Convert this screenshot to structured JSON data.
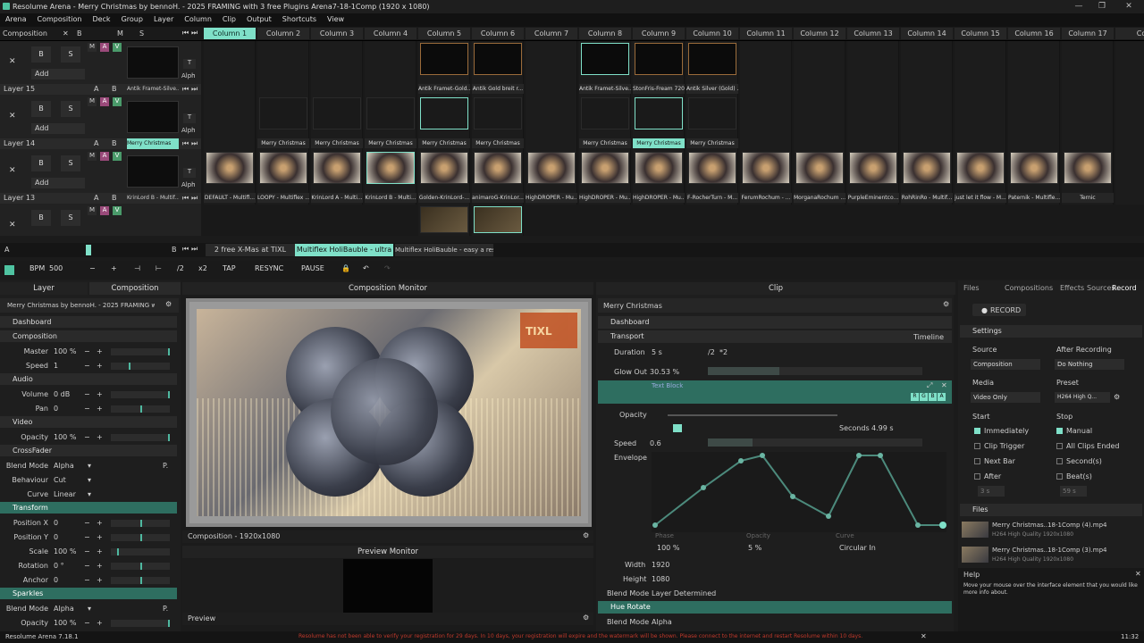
{
  "window": {
    "title": "Resolume Arena - Merry Christmas  by bennoH. - 2025  FRAMING  with 3 free Plugins Arena7-18-1Comp  (1920 x 1080)"
  },
  "menu": [
    "Arena",
    "Composition",
    "Deck",
    "Group",
    "Layer",
    "Column",
    "Clip",
    "Output",
    "Shortcuts",
    "View"
  ],
  "composition_label": "Composition",
  "columns": [
    "Column 1",
    "Column 2",
    "Column 3",
    "Column 4",
    "Column 5",
    "Column 6",
    "Column 7",
    "Column 8",
    "Column 9",
    "Column 10",
    "Column 11",
    "Column 12",
    "Column 13",
    "Column 14",
    "Column 15",
    "Column 16",
    "Column 17",
    "Co"
  ],
  "layer_buttons": {
    "x": "✕",
    "b": "B",
    "s": "S",
    "add": "Add",
    "m": "M",
    "a": "A",
    "v": "V",
    "t": "T",
    "alph": "Alph"
  },
  "layers": [
    {
      "name": "Layer 15",
      "clip": "Antik Framet-Silve...",
      "clips": [
        "",
        "",
        "",
        "",
        "Antik Framet-Gold...",
        "Antik Gold breit r...",
        "",
        "Antik Framet-Silve...",
        "StonFris-Fream 720p",
        "Antik Silver (Gold) ...",
        "",
        "",
        "",
        "",
        "",
        "",
        "",
        ""
      ]
    },
    {
      "name": "Layer 14",
      "clip": "Merry Christmas",
      "clips": [
        "",
        "Merry Christmas",
        "Merry Christmas",
        "Merry Christmas",
        "Merry Christmas",
        "Merry Christmas",
        "",
        "Merry Christmas",
        "Merry Christmas",
        "Merry Christmas",
        "",
        "",
        "",
        "",
        "",
        "",
        "",
        ""
      ]
    },
    {
      "name": "Layer 13",
      "clip": "KrinLord B - Multif...",
      "clips": [
        "DEFAULT - Multifl...",
        "LOOPY - Multiflex ...",
        "KrinLord A - Multi...",
        "KrinLord B - Multi...",
        "Golden-KrinLord-...",
        "animaroG-KrinLor...",
        "HighDROPER - Mu...",
        "HighDROPER - Mu...",
        "HighDROPER - Mu...",
        "F-RocherTurn - M...",
        "FerumRochum - ...",
        "MorganaRochum ...",
        "PurpleEminentco...",
        "RohRinRo - Multif...",
        "just let it flow - M...",
        "Paternik - Multifle...",
        "Ternic",
        ""
      ]
    }
  ],
  "deck_tabs": [
    "2 free X-Mas at TIXL",
    "Multiflex HoliBauble - ultra",
    "Multiflex HoliBauble - easy  a resoPlu..."
  ],
  "deck_tab_a": "A",
  "transport": {
    "bpm_label": "BPM",
    "bpm": "500",
    "minus": "−",
    "plus": "+",
    "half": "/2",
    "double": "x2",
    "tap": "TAP",
    "resync": "RESYNC",
    "pause": "PAUSE"
  },
  "left_tabs": [
    "Layer",
    "Composition"
  ],
  "comp_name": "Merry Christmas  by bennoH. - 2025  FRAMING  with 3 free ...",
  "comp_props": [
    {
      "type": "sec",
      "label": "Dashboard"
    },
    {
      "type": "sec",
      "label": "Composition"
    },
    {
      "type": "prop",
      "name": "Master",
      "value": "100 %",
      "level": 1.0
    },
    {
      "type": "prop",
      "name": "Speed",
      "value": "1",
      "level": 0.3
    },
    {
      "type": "sec",
      "label": "Audio"
    },
    {
      "type": "prop",
      "name": "Volume",
      "value": "0 dB",
      "level": 1.0
    },
    {
      "type": "prop",
      "name": "Pan",
      "value": "0",
      "level": 0.5
    },
    {
      "type": "sec",
      "label": "Video"
    },
    {
      "type": "prop",
      "name": "Opacity",
      "value": "100 %",
      "level": 1.0
    },
    {
      "type": "sec",
      "label": "CrossFader"
    },
    {
      "type": "dd",
      "name": "Blend Mode",
      "value": "Alpha"
    },
    {
      "type": "dd",
      "name": "Behaviour",
      "value": "Cut"
    },
    {
      "type": "dd",
      "name": "Curve",
      "value": "Linear"
    },
    {
      "type": "secteal",
      "label": "Transform"
    },
    {
      "type": "prop",
      "name": "Position X",
      "value": "0",
      "level": 0.5
    },
    {
      "type": "prop",
      "name": "Position Y",
      "value": "0",
      "level": 0.5
    },
    {
      "type": "prop",
      "name": "Scale",
      "value": "100 %",
      "level": 0.1
    },
    {
      "type": "prop",
      "name": "Rotation",
      "value": "0 °",
      "level": 0.5
    },
    {
      "type": "prop",
      "name": "Anchor",
      "value": "0",
      "level": 0.5
    },
    {
      "type": "secteal",
      "label": "Sparkles"
    },
    {
      "type": "dd",
      "name": "Blend Mode",
      "value": "Alpha"
    },
    {
      "type": "prop",
      "name": "Opacity",
      "value": "100 %",
      "level": 1.0
    }
  ],
  "monitor": {
    "title": "Composition Monitor",
    "footer": "Composition - 1920x1080",
    "preview_title": "Preview Monitor",
    "preview_label": "Preview",
    "logo": "TIXL"
  },
  "clip_panel": {
    "title": "Clip",
    "clip_name": "Merry Christmas",
    "dashboard": "Dashboard",
    "transport": "Transport",
    "timeline": "Timeline",
    "duration_label": "Duration",
    "duration": "5 s",
    "div2": "/2",
    "mul2": "*2",
    "glow_label": "Glow Out",
    "glow": "30.53 %",
    "text_block": "Text Block",
    "rgba": [
      "R",
      "G",
      "B",
      "A"
    ],
    "opacity_label": "Opacity",
    "seconds_label": "Seconds",
    "seconds": "4.99 s",
    "speed_label": "Speed",
    "speed": "0.6",
    "envelope": "Envelope",
    "env_phase": "Phase",
    "env_phase_val": "100 %",
    "env_opacity": "Opacity",
    "env_opacity_val": "5 %",
    "env_curve": "Curve",
    "env_curve_val": "Circular In",
    "width_label": "Width",
    "width": "1920",
    "height_label": "Height",
    "height": "1080",
    "blend_label": "Blend Mode",
    "blend": "Layer Determined",
    "hue": "Hue Rotate",
    "blend2": "Alpha"
  },
  "right_panel": {
    "tabs": [
      "Files",
      "Compositions",
      "Effects",
      "Sources",
      "Record"
    ],
    "record": "RECORD",
    "settings": "Settings",
    "source_label": "Source",
    "source": "Composition",
    "after_label": "After Recording",
    "after": "Do Nothing",
    "media_label": "Media",
    "media": "Video Only",
    "preset_label": "Preset",
    "preset": "H264 High Q...",
    "start_label": "Start",
    "stop_label": "Stop",
    "start_opts": [
      {
        "l": "Immediately",
        "on": true
      },
      {
        "l": "Clip Trigger",
        "on": false
      },
      {
        "l": "Next Bar",
        "on": false
      },
      {
        "l": "After",
        "on": false
      }
    ],
    "stop_opts": [
      {
        "l": "Manual",
        "on": true
      },
      {
        "l": "All Clips Ended",
        "on": false
      },
      {
        "l": "Second(s)",
        "on": false
      },
      {
        "l": "Beat(s)",
        "on": false
      }
    ],
    "after_val": "3 s",
    "beats_val": "59 s",
    "files_label": "Files",
    "files": [
      {
        "name": "Merry Christmas..18-1Comp (4).mp4",
        "sub": "H264 High Quality 1920x1080"
      },
      {
        "name": "Merry Christmas..18-1Comp (3).mp4",
        "sub": "H264 High Quality 1920x1080"
      }
    ],
    "help_label": "Help",
    "help_text": "Move your mouse over the interface element that you would like more info about."
  },
  "status": {
    "version": "Resolume Arena 7.18.1",
    "warning": "Resolume has not been able to verify your registration for 29 days. In 10 days, your registration will expire and the watermark will be shown. Please connect to the internet and restart Resolume within 10 days.",
    "time": "11:32"
  },
  "colors": {
    "accent": "#7fe0c8",
    "teal": "#2e6e60",
    "warning": "#c0392b"
  }
}
